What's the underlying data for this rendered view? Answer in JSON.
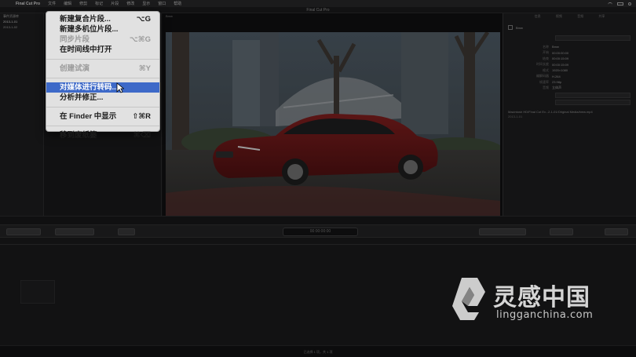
{
  "menubar": {
    "app_name": "Final Cut Pro",
    "items": [
      "文件",
      "编辑",
      "修剪",
      "标记",
      "片段",
      "修改",
      "显示",
      "窗口",
      "帮助"
    ]
  },
  "window": {
    "title": "Final Cut Pro"
  },
  "library": {
    "rows": [
      "事件资源库",
      "2013-1-01",
      "2013-1-02"
    ]
  },
  "viewer": {
    "clip_name": "Bmw"
  },
  "inspector": {
    "tabs": [
      "信息",
      "视频",
      "音频",
      "共享"
    ],
    "clip_name": "Bmw",
    "meta": [
      {
        "k": "名称",
        "v": "Bmw"
      },
      {
        "k": "开始",
        "v": "00:00:00:00"
      },
      {
        "k": "结束",
        "v": "00:00:15:09"
      },
      {
        "k": "时间长度",
        "v": "00:00:15:09"
      },
      {
        "k": "格式",
        "v": "1920×1080"
      },
      {
        "k": "编解码器",
        "v": "H.264"
      },
      {
        "k": "帧速率",
        "v": "23.98p"
      },
      {
        "k": "音频",
        "v": "立体声"
      }
    ],
    "path": "Macintosh HD/Final Cut Ev...2-1-01/Original Media/bmw.mp4",
    "event": "2013-1-01"
  },
  "toolbar": {
    "timecode": "00:00:00:00"
  },
  "statusbar": {
    "text": "已选择 1 项，共 1 项"
  },
  "context_menu": {
    "items": [
      {
        "label": "新建复合片段...",
        "shortcut": "⌥G",
        "state": "enabled"
      },
      {
        "label": "新建多机位片段...",
        "shortcut": "",
        "state": "enabled"
      },
      {
        "label": "同步片段",
        "shortcut": "⌥⌘G",
        "state": "disabled"
      },
      {
        "label": "在时间线中打开",
        "shortcut": "",
        "state": "enabled"
      },
      {
        "label": "创建试演",
        "shortcut": "⌘Y",
        "state": "disabled"
      },
      {
        "label": "对媒体进行转码...",
        "shortcut": "",
        "state": "highlighted"
      },
      {
        "label": "分析并修正...",
        "shortcut": "",
        "state": "enabled"
      },
      {
        "label": "在 Finder 中显示",
        "shortcut": "⇧⌘R",
        "state": "enabled"
      },
      {
        "label": "移到废纸篓",
        "shortcut": "⌘⌫",
        "state": "enabled"
      }
    ]
  },
  "watermark": {
    "title": "灵感中国",
    "url": "lingganchina.com"
  }
}
